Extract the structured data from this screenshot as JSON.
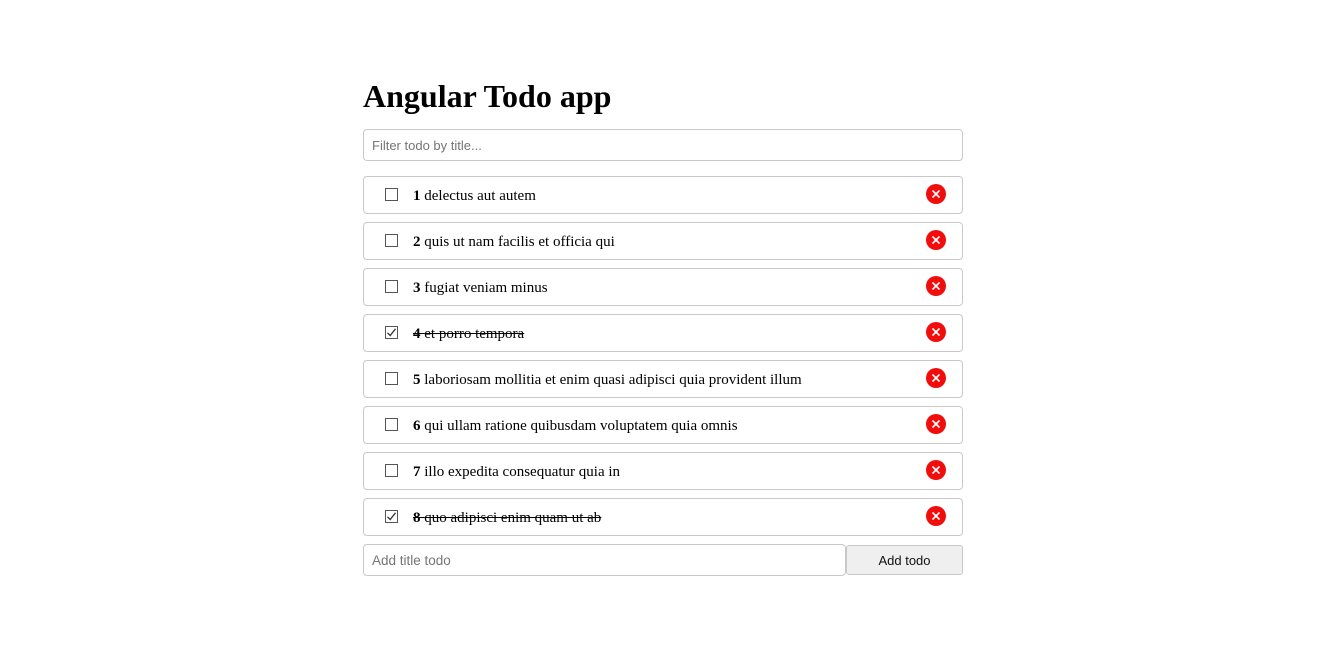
{
  "app": {
    "title": "Angular Todo app"
  },
  "filter": {
    "placeholder": "Filter todo by title...",
    "value": ""
  },
  "todos": [
    {
      "id": "1",
      "title": "delectus aut autem",
      "completed": false
    },
    {
      "id": "2",
      "title": "quis ut nam facilis et officia qui",
      "completed": false
    },
    {
      "id": "3",
      "title": "fugiat veniam minus",
      "completed": false
    },
    {
      "id": "4",
      "title": "et porro tempora",
      "completed": true
    },
    {
      "id": "5",
      "title": "laboriosam mollitia et enim quasi adipisci quia provident illum",
      "completed": false
    },
    {
      "id": "6",
      "title": "qui ullam ratione quibusdam voluptatem quia omnis",
      "completed": false
    },
    {
      "id": "7",
      "title": "illo expedita consequatur quia in",
      "completed": false
    },
    {
      "id": "8",
      "title": "quo adipisci enim quam ut ab",
      "completed": true
    }
  ],
  "add_form": {
    "placeholder": "Add title todo",
    "value": "",
    "button_label": "Add todo"
  },
  "icons": {
    "checkbox": "checkbox-icon",
    "delete": "close-icon"
  },
  "colors": {
    "delete_button": "#f20d0d",
    "border": "#c9c9c9"
  }
}
